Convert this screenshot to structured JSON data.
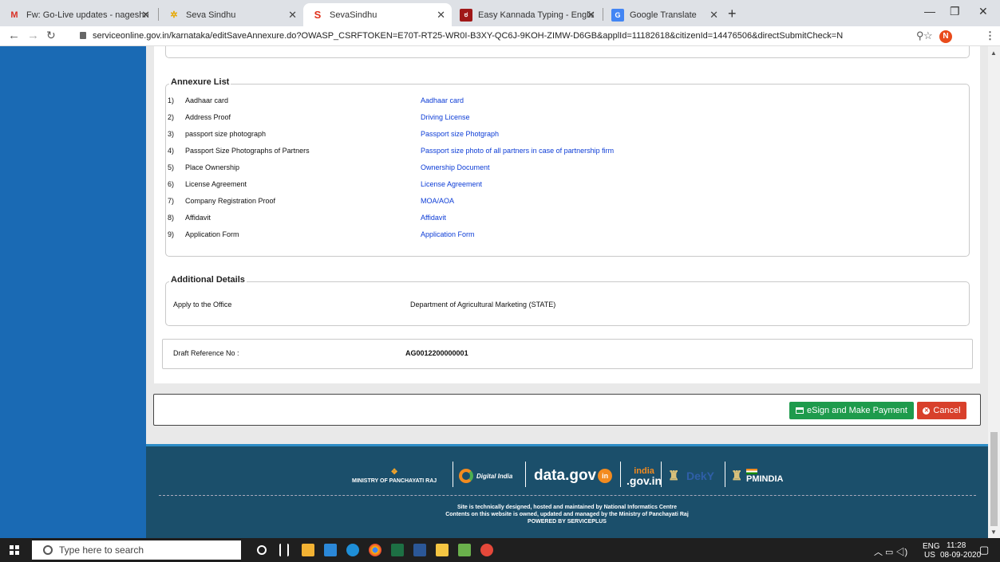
{
  "browser": {
    "tabs": [
      {
        "title": "Fw: Go-Live updates - nageshnm",
        "icon": "gmail-icon",
        "active": false
      },
      {
        "title": "Seva Sindhu",
        "icon": "seva-sindhu-icon",
        "active": false
      },
      {
        "title": "SevaSindhu",
        "icon": "seva-sindhu-icon",
        "active": true
      },
      {
        "title": "Easy Kannada Typing - English to",
        "icon": "kannada-typing-icon",
        "active": false
      },
      {
        "title": "Google Translate",
        "icon": "google-translate-icon",
        "active": false
      }
    ],
    "new_tab": "+",
    "url": "serviceonline.gov.in/karnataka/editSaveAnnexure.do?OWASP_CSRFTOKEN=E70T-RT25-WR0I-B3XY-QC6J-9KOH-ZIMW-D6GB&applId=11182618&citizenId=14476506&directSubmitCheck=N",
    "profile_initial": "N"
  },
  "annexure": {
    "legend": "Annexure List",
    "items": [
      {
        "num": "1)",
        "name": "Aadhaar card",
        "doc": "Aadhaar card"
      },
      {
        "num": "2)",
        "name": "Address Proof",
        "doc": "Driving License"
      },
      {
        "num": "3)",
        "name": "passport size photograph",
        "doc": "Passport size Photgraph"
      },
      {
        "num": "4)",
        "name": "Passport Size Photographs of Partners",
        "doc": "Passport size photo of all partners in case of partnership firm"
      },
      {
        "num": "5)",
        "name": "Place Ownership",
        "doc": "Ownership Document"
      },
      {
        "num": "6)",
        "name": "License Agreement",
        "doc": "License Agreement"
      },
      {
        "num": "7)",
        "name": "Company Registration Proof",
        "doc": "MOA/AOA"
      },
      {
        "num": "8)",
        "name": "Affidavit",
        "doc": "Affidavit"
      },
      {
        "num": "9)",
        "name": "Application Form",
        "doc": "Application Form"
      }
    ]
  },
  "additional": {
    "legend": "Additional Details",
    "label": "Apply to the Office",
    "value": "Department of Agricultural Marketing (STATE)"
  },
  "draft": {
    "label": "Draft Reference No :",
    "value": "AG0012200000001"
  },
  "actions": {
    "esign_label": "eSign and Make Payment",
    "cancel_label": "Cancel"
  },
  "footer": {
    "logos": {
      "panchayati": "MINISTRY OF PANCHAYATI RAJ",
      "digital_india": "Digital India",
      "datagov": "data.gov",
      "datagov_in": "in",
      "indiagov": ".gov.in",
      "indiagov_top": "india",
      "pmindia": "PMINDIA"
    },
    "line1": "Site is technically designed, hosted and maintained by National Informatics Centre",
    "line2": "Contents on this website is owned, updated and managed by the Ministry of Panchayati Raj",
    "line3": "POWERED BY SERVICEPLUS"
  },
  "taskbar": {
    "search_placeholder": "Type here to search",
    "lang": "ENG",
    "region": "US",
    "time": "11:28",
    "date": "08-09-2020"
  }
}
